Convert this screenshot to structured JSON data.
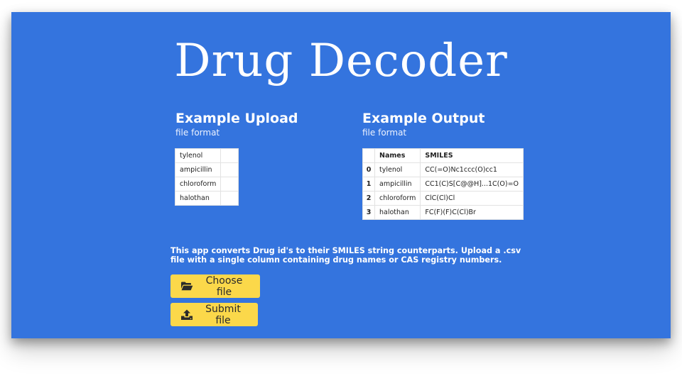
{
  "app": {
    "title": "Drug Decoder"
  },
  "upload_example": {
    "heading": "Example Upload",
    "subheading": "file format",
    "rows": [
      "tylenol",
      "ampicillin",
      "chloroform",
      "halothan"
    ]
  },
  "output_example": {
    "heading": "Example Output",
    "subheading": "file format",
    "columns": [
      "",
      "Names",
      "SMILES"
    ],
    "rows": [
      {
        "index": "0",
        "name": "tylenol",
        "smiles": "CC(=O)Nc1ccc(O)cc1"
      },
      {
        "index": "1",
        "name": "ampicillin",
        "smiles": "CC1(C)S[C@@H]...1C(O)=O"
      },
      {
        "index": "2",
        "name": "chloroform",
        "smiles": "ClC(Cl)Cl"
      },
      {
        "index": "3",
        "name": "halothan",
        "smiles": "FC(F)(F)C(Cl)Br"
      }
    ]
  },
  "description": "This app converts Drug id's to their SMILES string counterparts. Upload a .csv file with a single column containing drug names or CAS registry numbers.",
  "buttons": {
    "choose_label": "Choose file",
    "choose_icon": "folder-open-icon",
    "submit_label": "Submit file",
    "submit_icon": "upload-icon"
  },
  "colors": {
    "background": "#3474de",
    "button": "#fbd84a",
    "text": "#ffffff"
  }
}
